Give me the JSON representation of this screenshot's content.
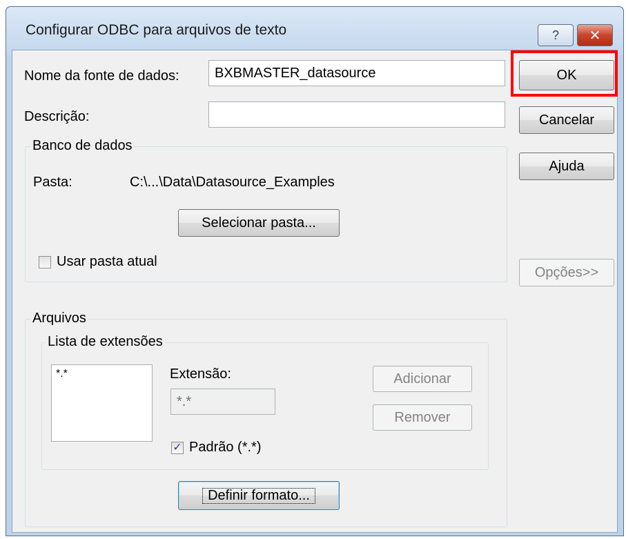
{
  "window": {
    "title": "Configurar ODBC para arquivos de texto",
    "help_glyph": "?",
    "close_glyph": "✕"
  },
  "fields": {
    "datasource_label": "Nome da fonte de dados:",
    "datasource_value": "BXBMASTER_datasource",
    "description_label": "Descrição:",
    "description_value": ""
  },
  "database": {
    "group_label": "Banco de dados",
    "folder_label": "Pasta:",
    "folder_value": "C:\\...\\Data\\Datasource_Examples",
    "select_folder_button": "Selecionar pasta...",
    "use_current_folder_label": "Usar pasta atual",
    "use_current_folder_checked": false
  },
  "files": {
    "group_label": "Arquivos",
    "extensions_group_label": "Lista de extensões",
    "extension_list": [
      "*.*"
    ],
    "extension_label": "Extensão:",
    "extension_value": "*.*",
    "add_button": "Adicionar",
    "remove_button": "Remover",
    "default_label": "Padrão (*.*)",
    "default_checked": true,
    "define_format_button": "Definir formato..."
  },
  "side_buttons": {
    "ok": "OK",
    "cancel": "Cancelar",
    "help": "Ajuda",
    "options": "Opções>>"
  },
  "colors": {
    "highlight": "#ff0000"
  }
}
